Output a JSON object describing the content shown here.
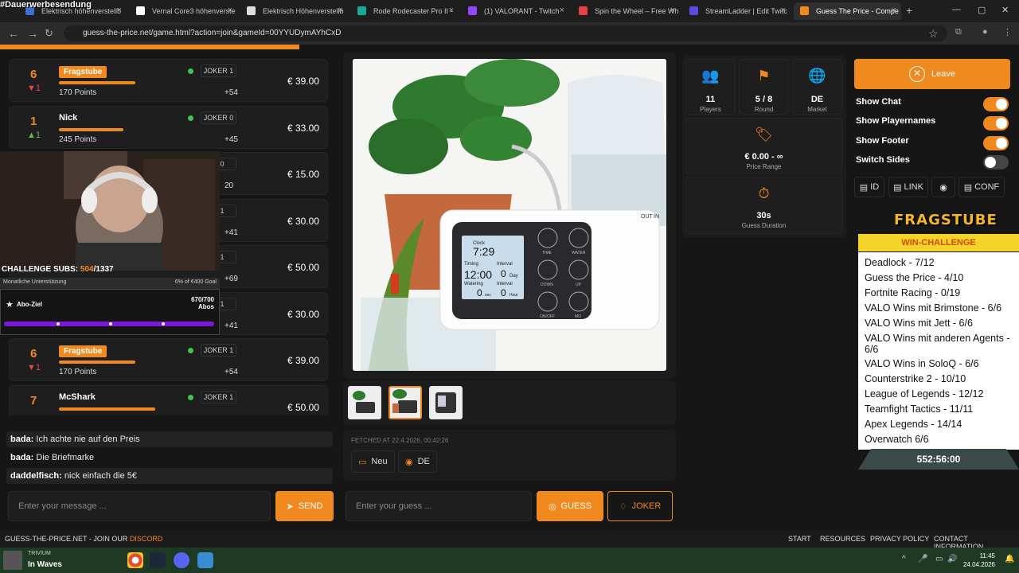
{
  "browser": {
    "tabs": [
      {
        "title": "Elektrisch höhenverstellb",
        "color": "#3b6fd4"
      },
      {
        "title": "Vernal Core3 höhenverste",
        "color": "#ffffff"
      },
      {
        "title": "Elektrisch Höhenverstellb",
        "color": "#dddddd"
      },
      {
        "title": "Rode Rodecaster Pro II -",
        "color": "#1aa89a"
      },
      {
        "title": "(1) VALORANT - Twitch",
        "color": "#9146ff"
      },
      {
        "title": "Spin the Wheel – Free Wh",
        "color": "#e84040"
      },
      {
        "title": "StreamLadder | Edit Twitc",
        "color": "#5a4ae0"
      },
      {
        "title": "Guess The Price - Compe",
        "color": "#f08a1e"
      }
    ],
    "url": "guess-the-price.net/game.html?action=join&gameId=00YYUDymAYhCxD"
  },
  "stream": {
    "tag": "#Dauerwerbesendung",
    "challenge_label": "CHALLENGE SUBS:",
    "challenge_current": "504",
    "challenge_total": "/1337",
    "monthly_label": "Monatliche Unterstützung",
    "monthly_progress": "6% of €400 Goal",
    "abo_label": "Abo-Ziel",
    "abo_count": "670/700",
    "abo_unit": "Abos",
    "abo_fraction": 0.957
  },
  "players": [
    {
      "rank": "6",
      "delta": "▼1",
      "dir": "down",
      "name": "Fragstube",
      "badge": true,
      "bar": 0.62,
      "points": "170 Points",
      "joker": "JOKER 1",
      "plus": "+54",
      "price": "€ 39.00"
    },
    {
      "rank": "1",
      "delta": "▲1",
      "dir": "up",
      "name": "Nick",
      "badge": false,
      "bar": 0.52,
      "points": "245 Points",
      "joker": "JOKER 0",
      "plus": "+45",
      "price": "€ 33.00"
    },
    {
      "rank": "",
      "delta": "",
      "dir": "up",
      "name": "",
      "badge": false,
      "bar": 0,
      "points": "",
      "joker": "R 0",
      "plus": "20",
      "price": "€ 15.00"
    },
    {
      "rank": "",
      "delta": "",
      "dir": "up",
      "name": "",
      "badge": false,
      "bar": 0,
      "points": "",
      "joker": "R 1",
      "plus": "+41",
      "price": "€ 30.00"
    },
    {
      "rank": "",
      "delta": "",
      "dir": "up",
      "name": "",
      "badge": false,
      "bar": 0,
      "points": "",
      "joker": "R 1",
      "plus": "+69",
      "price": "€ 50.00"
    },
    {
      "rank": "",
      "delta": "",
      "dir": "up",
      "name": "",
      "badge": false,
      "bar": 0,
      "points": "",
      "joker": "R 1",
      "plus": "+41",
      "price": "€ 30.00"
    },
    {
      "rank": "6",
      "delta": "▼1",
      "dir": "down",
      "name": "Fragstube",
      "badge": true,
      "bar": 0.62,
      "points": "170 Points",
      "joker": "JOKER 1",
      "plus": "+54",
      "price": "€ 39.00"
    },
    {
      "rank": "7",
      "delta": "",
      "dir": "up",
      "name": "McShark",
      "badge": false,
      "bar": 0.78,
      "points": "",
      "joker": "JOKER 1",
      "plus": "",
      "price": "€ 50.00"
    }
  ],
  "chat": {
    "messages": [
      {
        "user": "bada:",
        "text": "Ich achte nie auf den Preis"
      },
      {
        "user": "bada:",
        "text": "Die Briefmarke"
      },
      {
        "user": "daddelfisch:",
        "text": "nick einfach die 5€"
      }
    ],
    "placeholder": "Enter your message ...",
    "send_label": "SEND"
  },
  "product": {
    "fetched": "FETCHED AT 22.4.2026, 00:42:26",
    "condition": "Neu",
    "market": "DE",
    "screen": {
      "clock_label": "Clock",
      "clock_time": "7:29",
      "timing_label": "Timing",
      "timing_time": "12:00",
      "interval_label": "Interval",
      "interval_value": "0",
      "interval_unit": "Day",
      "watering_label": "Watering",
      "watering_value": "0",
      "watering_unit": "sec",
      "interval2_label": "Interval",
      "interval2_value": "0",
      "interval2_unit": "Hour"
    },
    "device_buttons": [
      "TIME",
      "WATER",
      "DOWN",
      "UP",
      "ON/OFF",
      "MO"
    ],
    "device_labels": {
      "out": "OUT",
      "in": "IN"
    }
  },
  "guess": {
    "placeholder": "Enter your guess ...",
    "guess_label": "GUESS",
    "joker_label": "JOKER"
  },
  "stats": {
    "players_value": "11",
    "players_label": "Players",
    "round_value": "5 / 8",
    "round_label": "Round",
    "market_value": "DE",
    "market_label": "Market",
    "range_value": "€ 0.00 - ∞",
    "range_label": "Price Range",
    "duration_value": "30s",
    "duration_label": "Guess Duration"
  },
  "settings": {
    "leave_label": "Leave",
    "toggles": [
      {
        "label": "Show Chat",
        "on": true
      },
      {
        "label": "Show Playernames",
        "on": true
      },
      {
        "label": "Show Footer",
        "on": true
      },
      {
        "label": "Switch Sides",
        "on": false
      }
    ],
    "buttons": [
      "ID",
      "LINK",
      "",
      "CONF"
    ]
  },
  "overlay": {
    "logo": "FRAGSTUBE",
    "subtitle": "WIN-CHALLENGE",
    "challenges": [
      "Deadlock - 7/12",
      "Guess the Price - 4/10",
      "Fortnite Racing - 0/19",
      "VALO Wins mit Brimstone - 6/6",
      "VALO Wins mit Jett - 6/6",
      "VALO Wins mit anderen Agents - 6/6",
      "VALO Wins in SoloQ - 6/6",
      "Counterstrike 2 - 10/10",
      "League of Legends - 12/12",
      "Teamfight Tactics - 11/11",
      "Apex Legends - 14/14",
      "Overwatch 6/6"
    ],
    "timer": "552:56:00"
  },
  "footer": {
    "left": "GUESS-THE-PRICE.NET - JOIN OUR",
    "discord": "DISCORD",
    "links": [
      "START",
      "RESOURCES",
      "PRIVACY POLICY",
      "CONTACT INFORMATION"
    ]
  },
  "taskbar": {
    "media_app": "TRIVIUM",
    "media_title": "In Waves",
    "time": "11:45",
    "date": "24.04.2026"
  }
}
